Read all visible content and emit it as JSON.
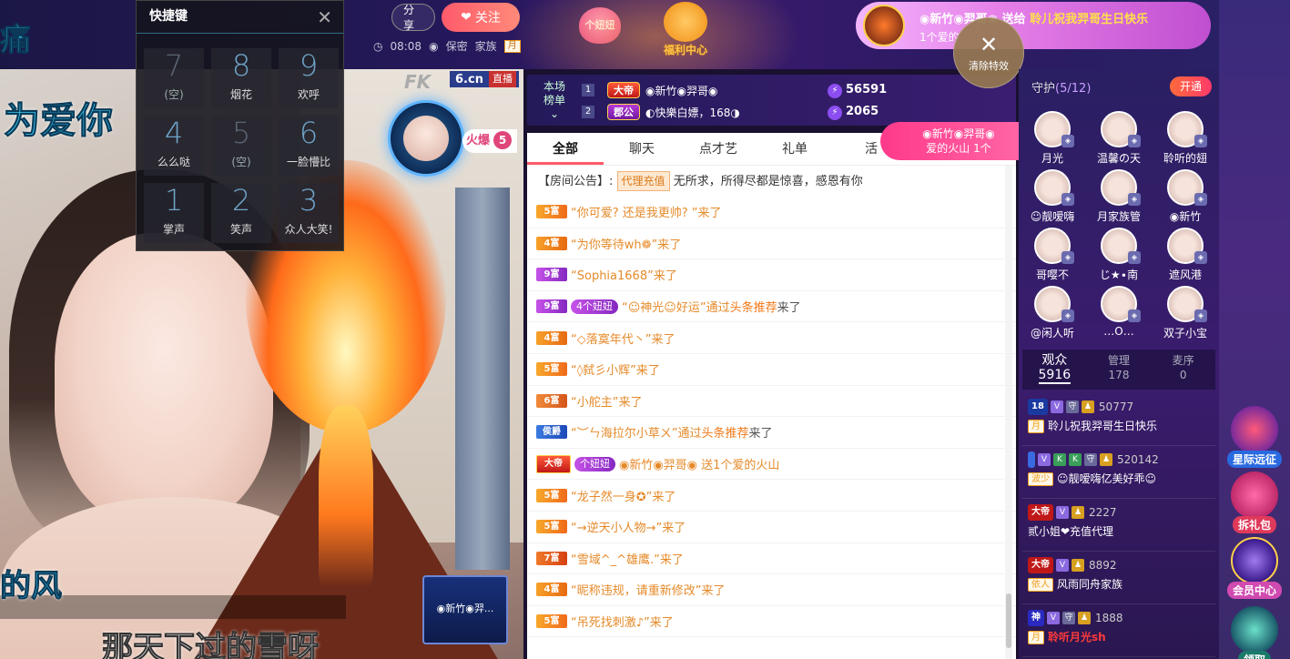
{
  "top": {
    "title_fragment": "痛",
    "share": "分享",
    "follow": "关注",
    "time": "08:08",
    "location": "保密",
    "family": "家族",
    "month_badge": "月",
    "gift_heart_label": "个妞妞",
    "welfare": "福利中心",
    "banner": {
      "sender": "◉新竹◉羿哥◉",
      "verb": "送给",
      "recipient": "聆儿祝我羿哥生日快乐",
      "line2": "1个爱的"
    },
    "clear_effects": "清除特效"
  },
  "shortcut_panel": {
    "title": "快捷键",
    "keys": [
      {
        "num": "7",
        "label": "(空)"
      },
      {
        "num": "8",
        "label": "烟花"
      },
      {
        "num": "9",
        "label": "欢呼"
      },
      {
        "num": "4",
        "label": "么么哒"
      },
      {
        "num": "5",
        "label": "(空)"
      },
      {
        "num": "6",
        "label": "一脸懵比"
      },
      {
        "num": "1",
        "label": "掌声"
      },
      {
        "num": "2",
        "label": "笑声"
      },
      {
        "num": "3",
        "label": "众人大笑!"
      }
    ]
  },
  "video": {
    "lyric_top": "为爱你",
    "lyric_mid": "的风",
    "lyric_bottom": "那天下过的雪呀",
    "brand_fk": "FK",
    "brand_site": "6.cn",
    "live_tag": "直播",
    "fire_label": "火爆",
    "fire_count": "5",
    "bottom_badge_name": "◉新竹◉羿..."
  },
  "rank": {
    "label_line1": "本场",
    "label_line2": "榜单",
    "rows": [
      {
        "pos": "1",
        "medal": "大帝",
        "name": "◉新竹◉羿哥◉",
        "value": "56591"
      },
      {
        "pos": "2",
        "medal": "郡公",
        "name": "◐快樂白嫖，168◑",
        "value": "2065"
      }
    ]
  },
  "gift_pill": {
    "line1": "◉新竹◉羿哥◉",
    "line2": "爱的火山 1个"
  },
  "tabs": [
    "全部",
    "聊天",
    "点才艺",
    "礼单",
    "活"
  ],
  "notice": {
    "prefix": "【房间公告】:",
    "tag": "代理充值",
    "text": "无所求，所得尽都是惊喜，感恩有你"
  },
  "messages": [
    {
      "lv": "5富",
      "cls": "lv5",
      "text": "“你可爱? 还是我更帅? ”来了"
    },
    {
      "lv": "4富",
      "cls": "lv4",
      "text": "“为你等待wh❁”来了"
    },
    {
      "lv": "9富",
      "cls": "lv9",
      "text": "“Sophia1668”来了"
    },
    {
      "lv": "9富",
      "cls": "lv9",
      "badge": "4个妞妞",
      "text": "“☺神光☺好运”通过",
      "link": "头条推荐",
      "tail": "来了"
    },
    {
      "lv": "4富",
      "cls": "lv4",
      "text": "“◇落寞年代丶”来了"
    },
    {
      "lv": "5富",
      "cls": "lv5",
      "text": "“◊弑彡小辉”来了"
    },
    {
      "lv": "6富",
      "cls": "lv6",
      "text": "“小舵主”来了"
    },
    {
      "lv": "侯爵",
      "cls": "lvg",
      "text": "“︶ㄣ海拉尔小草ㄨ”通过",
      "link": "头条推荐",
      "tail": "来了"
    },
    {
      "lv": "大帝",
      "cls": "lvdi",
      "badge": "个妞妞",
      "text": "◉新竹◉羿哥◉ 送1个爱的火山"
    },
    {
      "lv": "5富",
      "cls": "lv5",
      "text": "“龙子然一身✪”来了"
    },
    {
      "lv": "5富",
      "cls": "lv5",
      "text": "“→逆天小人物→”来了"
    },
    {
      "lv": "7富",
      "cls": "lv7",
      "text": "“雪域^_^雄鹰.”来了"
    },
    {
      "lv": "4富",
      "cls": "lv4",
      "text": "“昵称违规，请重新修改”来了"
    },
    {
      "lv": "5富",
      "cls": "lv5",
      "text": "“吊死找刺激♪”来了"
    }
  ],
  "guards": {
    "title": "守护",
    "count": "5",
    "total": "12",
    "open_btn": "开通",
    "list": [
      "月光",
      "温馨の天",
      "聆听的翅",
      "☺靓嗳嗨",
      "月家族管",
      "◉新竹",
      "哥嘤不",
      "じ★∙南",
      "遮风港",
      "@闲人听",
      "…O…",
      "双子小宝"
    ]
  },
  "audience_tabs": [
    {
      "label": "观众",
      "value": "5916"
    },
    {
      "label": "管理",
      "value": "178"
    },
    {
      "label": "麦序",
      "value": "0"
    }
  ],
  "audience": [
    {
      "badge": "18",
      "num": "50777",
      "fan": "月",
      "name": "聆儿祝我羿哥生日快乐"
    },
    {
      "badge": "",
      "num": "520142",
      "fan": "波少",
      "name": "☺靓嗳嗨亿美好乖☺"
    },
    {
      "badge": "大帝",
      "num": "2227",
      "fan": "",
      "name": "贰小姐❤充值代理"
    },
    {
      "badge": "大帝",
      "num": "8892",
      "fan": "依人",
      "name": "风雨同舟家族"
    },
    {
      "badge": "神",
      "num": "1888",
      "fan": "月",
      "name": "聆听月光sh"
    }
  ],
  "side_buttons": [
    "星际远征",
    "拆礼包",
    "会员中心",
    "领取"
  ]
}
